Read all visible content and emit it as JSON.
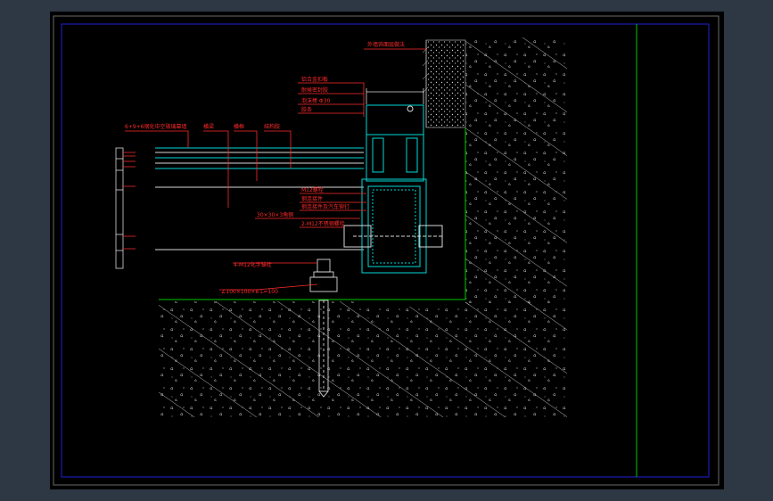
{
  "drawing": {
    "labels": {
      "exterior_finish": "外墙饰面层做法",
      "aluminum_panel": "铝合金扣板",
      "sealant_strip": "耐候密封胶",
      "foam_rod": "泡沫棒 Φ30",
      "structural_sealant": "胶条",
      "glass_spec": "6+9+6钢化中空玻璃幕墙",
      "mullion": "横梁",
      "transom": "横框",
      "pressure_plate": "结构胶",
      "anchor_bolt": "M12螺栓",
      "steel_connector": "钢连接件",
      "angle_steel": "30×30×3角钢",
      "bracket_spec": "钢连接件及汽车铆钉",
      "bolt_set": "2-M12不锈钢螺栓",
      "expansion_bolt": "4-M12化学锚栓",
      "embed_plate": "∠100×100×8  L=100"
    },
    "colors": {
      "background": "#000000",
      "outer_frame": "#6a6a6a",
      "sheet_border": "#1f1fd8",
      "accent_line": "#00c800",
      "profile": "#00d8d8",
      "annotation": "#ff2a2a",
      "hatch": "#d8d8d8"
    }
  }
}
